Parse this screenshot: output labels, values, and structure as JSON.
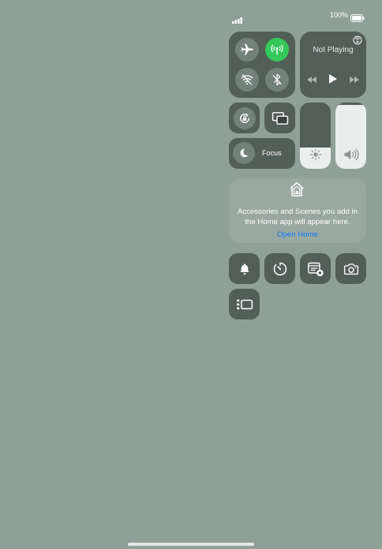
{
  "status_bar": {
    "battery_text": "100%",
    "battery_level": 1.0,
    "signal_bars": 4
  },
  "connectivity": {
    "airplane_mode": false,
    "cellular_data": true,
    "wifi": false,
    "bluetooth": false
  },
  "media": {
    "status": "Not Playing"
  },
  "focus": {
    "label": "Focus"
  },
  "sliders": {
    "brightness_level": 0.32,
    "volume_level": 0.97
  },
  "home": {
    "message": "Accessories and Scenes you add in the Home app will appear here.",
    "link": "Open Home"
  },
  "colors": {
    "background": "#8fa098",
    "active_green": "#34c759",
    "link_blue": "#0a7aff"
  }
}
